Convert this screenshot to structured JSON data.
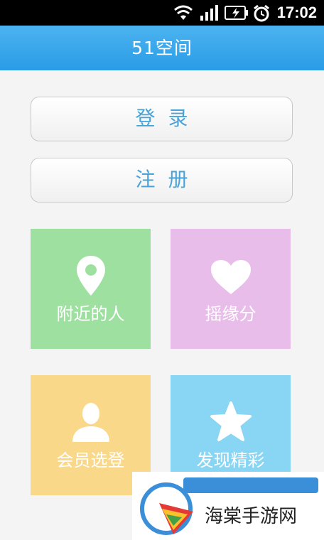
{
  "status_bar": {
    "time": "17:02",
    "icons": [
      "wifi-icon",
      "signal-icon",
      "battery-icon",
      "alarm-icon"
    ]
  },
  "header": {
    "title": "51空间"
  },
  "auth": {
    "login_label": "登录",
    "register_label": "注册"
  },
  "tiles": [
    {
      "label": "附近的人",
      "icon": "location-pin-icon",
      "color": "#9ee09f"
    },
    {
      "label": "摇缘分",
      "icon": "heart-icon",
      "color": "#e9bde9"
    },
    {
      "label": "会员选登",
      "icon": "user-icon",
      "color": "#f9d88a"
    },
    {
      "label": "发现精彩",
      "icon": "star-icon",
      "color": "#88d6f4"
    }
  ],
  "watermark": {
    "text": "海棠手游网"
  },
  "colors": {
    "accent": "#2a9ce6",
    "button_text": "#4aa3d6"
  }
}
